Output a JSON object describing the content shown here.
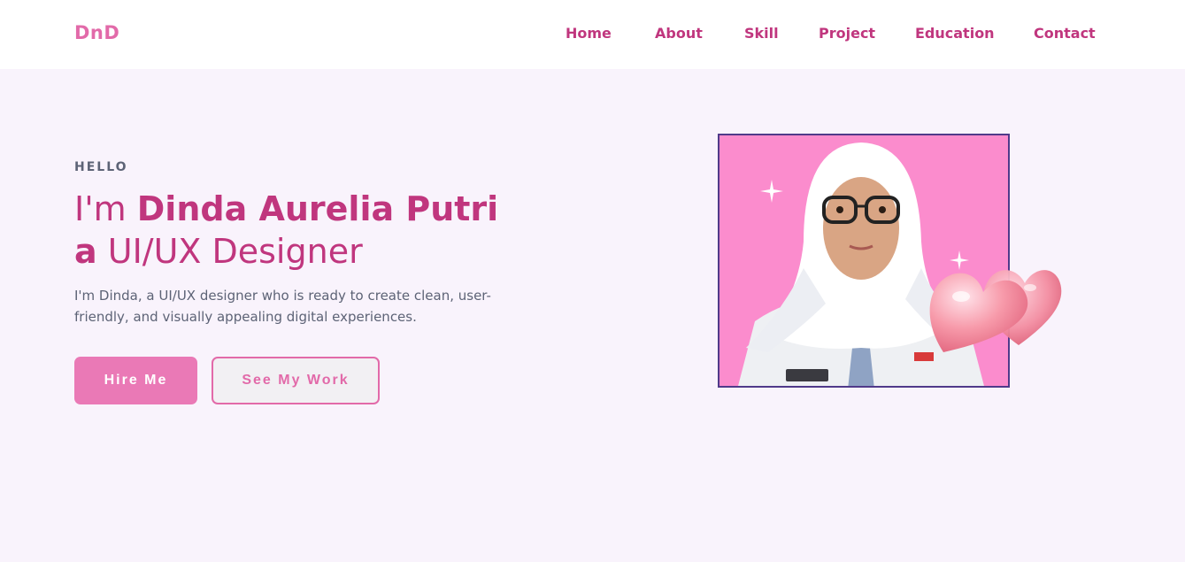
{
  "brand": {
    "logo": "DnD",
    "accent": "#c0367e",
    "logo_color": "#e26aa9"
  },
  "nav": {
    "items": [
      {
        "label": "Home"
      },
      {
        "label": "About"
      },
      {
        "label": "Skill"
      },
      {
        "label": "Project"
      },
      {
        "label": "Education"
      },
      {
        "label": "Contact"
      }
    ]
  },
  "hero": {
    "greeting": "HELLO",
    "intro_prefix": "I'm",
    "name": "Dinda Aurelia Putri",
    "role_prefix": "a",
    "role": "UI/UX Designer",
    "description": "I'm Dinda, a UI/UX designer who is ready to create clean, user-friendly, and visually appealing digital experiences.",
    "primary_button": "Hire Me",
    "secondary_button": "See My Work"
  },
  "colors": {
    "page_bg": "#f9f3fc",
    "photo_bg": "#fb8ccd",
    "photo_border": "#503a8a",
    "button_primary": "#ea79b6",
    "text_muted": "#5d6376"
  },
  "icons": [
    "sparkle-icon",
    "heart-balloon-icon"
  ]
}
